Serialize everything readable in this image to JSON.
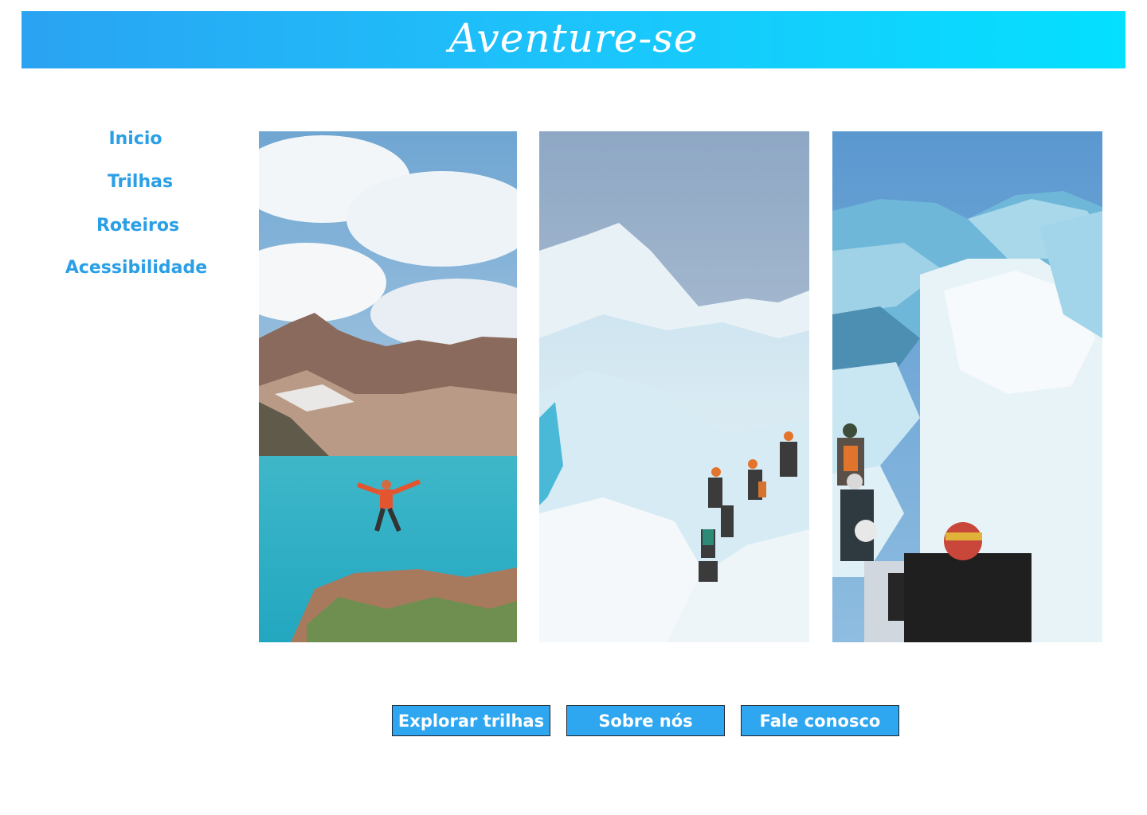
{
  "header": {
    "brand": "Aventure-se"
  },
  "nav": {
    "items": [
      {
        "label": "Inicio"
      },
      {
        "label": "Trilhas"
      },
      {
        "label": "Roteiros"
      },
      {
        "label": "Acessibilidade"
      }
    ]
  },
  "gallery": {
    "images": [
      {
        "icon": "photo-lake-jump"
      },
      {
        "icon": "photo-glacier-hikers"
      },
      {
        "icon": "photo-ice-formations"
      }
    ]
  },
  "actions": {
    "explore_label": "Explorar trilhas",
    "about_label": "Sobre nós",
    "contact_label": "Fale conosco"
  },
  "colors": {
    "accent": "#2a9fe6",
    "header_start": "#2aa3f2",
    "header_end": "#04e0ff",
    "button": "#2fa6f0"
  }
}
